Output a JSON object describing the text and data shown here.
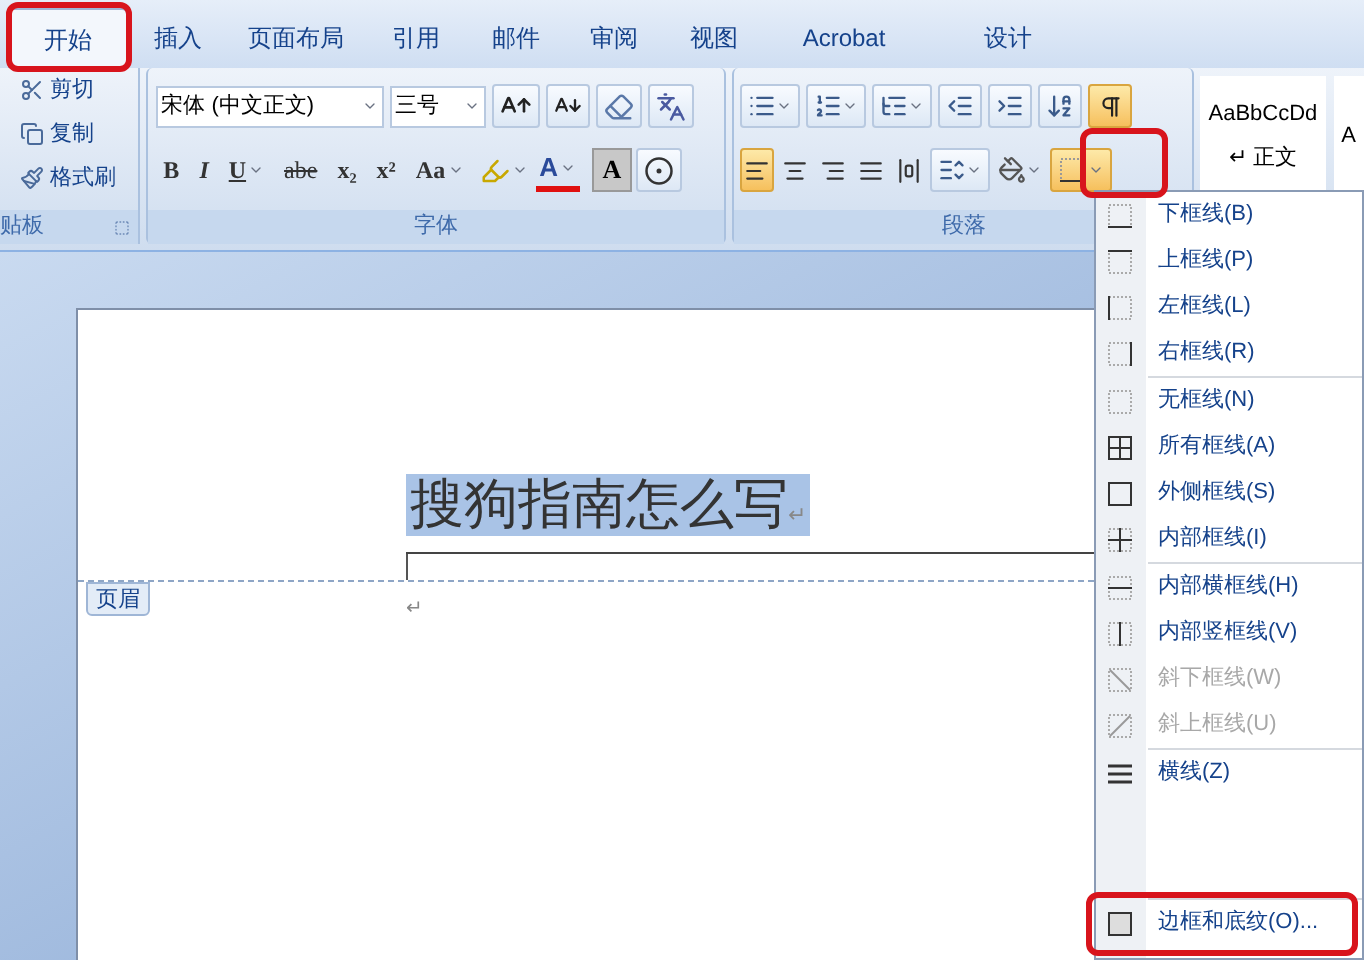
{
  "tabs": [
    {
      "label": "开始",
      "selected": true
    },
    {
      "label": "插入",
      "selected": false
    },
    {
      "label": "页面布局",
      "selected": false
    },
    {
      "label": "引用",
      "selected": false
    },
    {
      "label": "邮件",
      "selected": false
    },
    {
      "label": "审阅",
      "selected": false
    },
    {
      "label": "视图",
      "selected": false
    },
    {
      "label": "Acrobat",
      "selected": false
    },
    {
      "label": "设计",
      "selected": false
    }
  ],
  "clipboard": {
    "items": [
      "剪切",
      "复制",
      "格式刷"
    ],
    "group_label": "贴板"
  },
  "font": {
    "font_name": "宋体 (中文正文)",
    "font_size": "三号",
    "format_buttons": [
      "B",
      "I",
      "U",
      "abe",
      "x₂",
      "x²",
      "Aa"
    ],
    "font_color_button": "A",
    "shading_button": "A",
    "group_label": "字体"
  },
  "paragraph": {
    "alignment": [
      {
        "selected": true
      },
      {
        "selected": false
      },
      {
        "selected": false
      },
      {
        "selected": false
      },
      {
        "selected": false
      }
    ],
    "show_marks": {
      "selected": true
    },
    "borders_button": {
      "open": true
    },
    "group_label": "段落"
  },
  "styles": [
    {
      "preview": "AaBbCcDd",
      "mark": "↵",
      "name": "正文"
    },
    {
      "preview": "A"
    }
  ],
  "document": {
    "header_text": "搜狗指南怎么写",
    "header_selected": true,
    "header_mark": "↵",
    "header_tag": "页眉",
    "body_mark": "↵"
  },
  "border_menu": {
    "groups": [
      [
        {
          "label": "下框线(B)",
          "disabled": false
        },
        {
          "label": "上框线(P)",
          "disabled": false
        },
        {
          "label": "左框线(L)",
          "disabled": false
        },
        {
          "label": "右框线(R)",
          "disabled": false
        }
      ],
      [
        {
          "label": "无框线(N)",
          "disabled": false
        },
        {
          "label": "所有框线(A)",
          "disabled": false
        },
        {
          "label": "外侧框线(S)",
          "disabled": false
        },
        {
          "label": "内部框线(I)",
          "disabled": false
        }
      ],
      [
        {
          "label": "内部横框线(H)",
          "disabled": false
        },
        {
          "label": "内部竖框线(V)",
          "disabled": false
        },
        {
          "label": "斜下框线(W)",
          "disabled": true
        },
        {
          "label": "斜上框线(U)",
          "disabled": true
        }
      ],
      [
        {
          "label": "横线(Z)",
          "disabled": false
        }
      ]
    ],
    "last_item": {
      "label": "边框和底纹(O)...",
      "disabled": false
    }
  }
}
